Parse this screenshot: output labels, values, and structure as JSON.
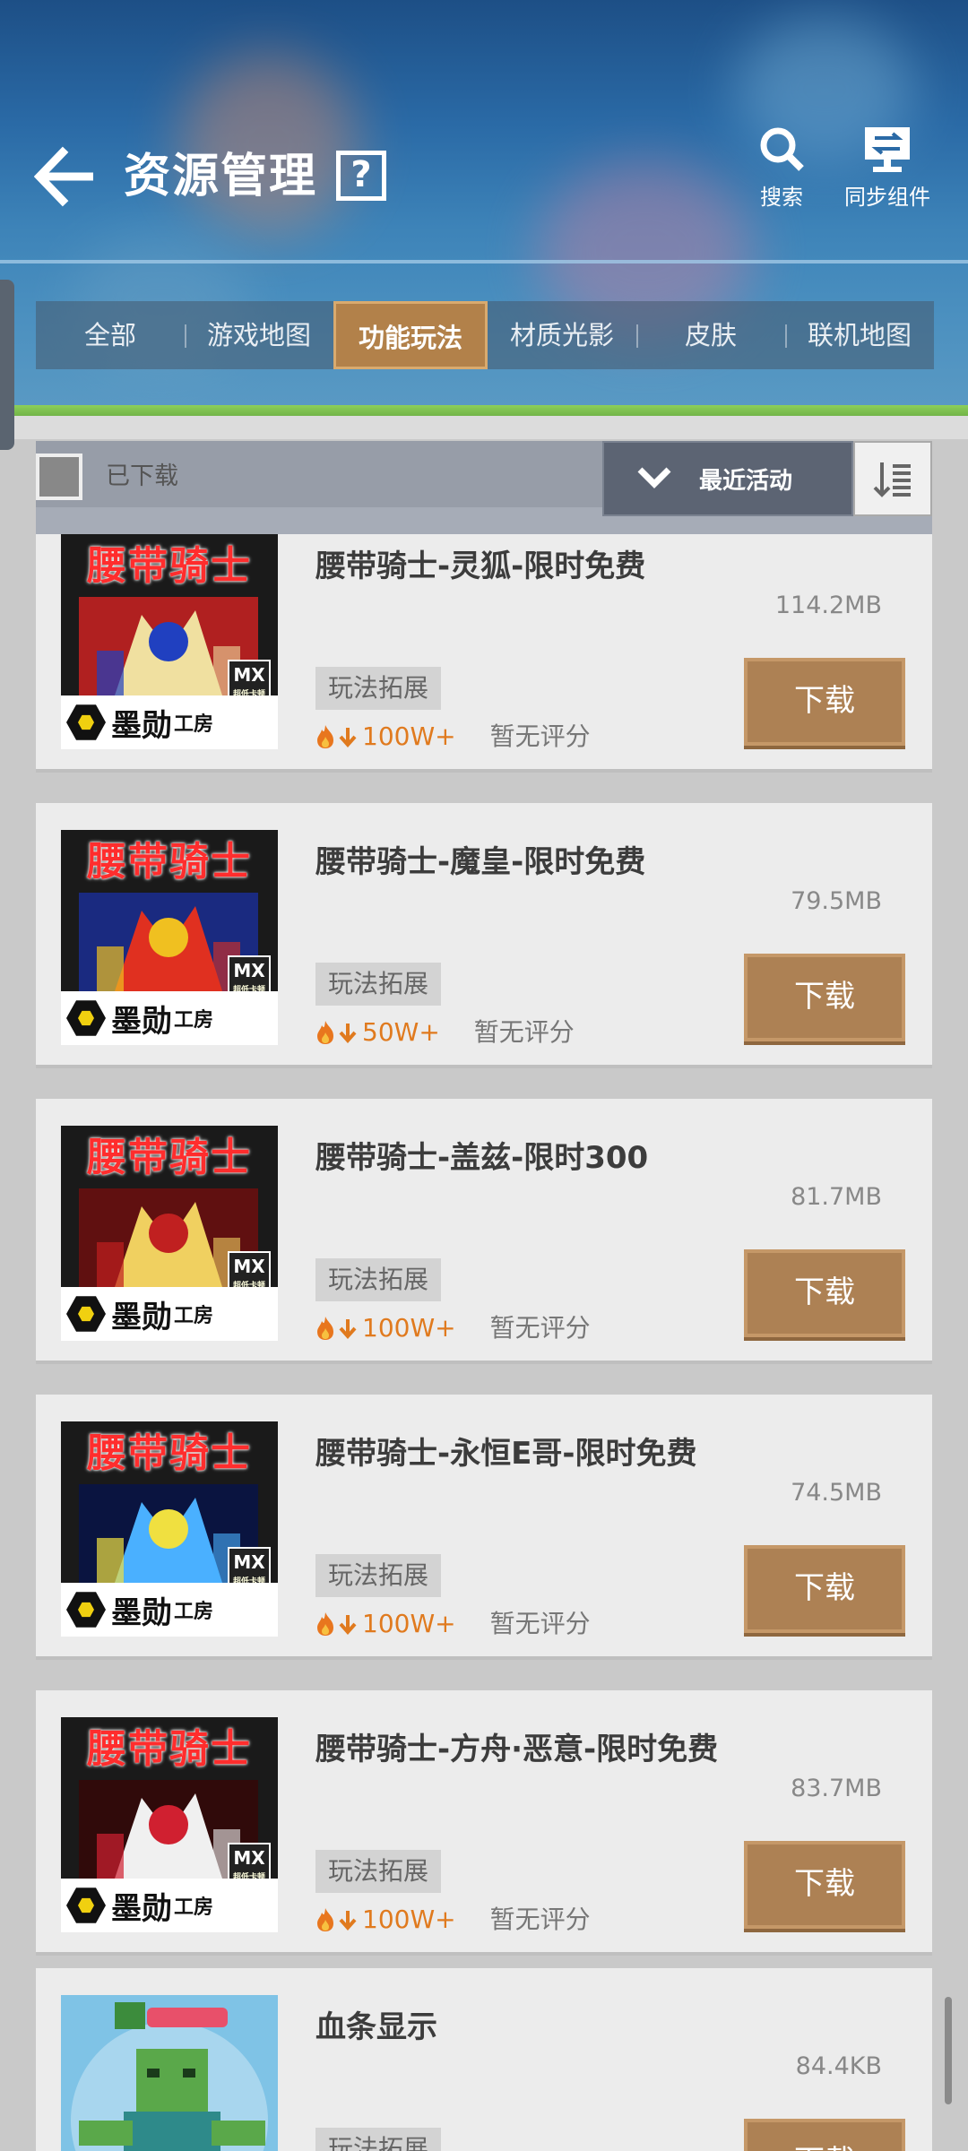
{
  "header": {
    "title": "资源管理",
    "help_icon": "?",
    "actions": {
      "search_label": "搜索",
      "sync_label": "同步组件"
    }
  },
  "tabs": [
    "全部",
    "游戏地图",
    "功能玩法",
    "材质光影",
    "皮肤",
    "联机地图"
  ],
  "active_tab": "功能玩法",
  "filter": {
    "downloaded_label": "已下载",
    "sort_label": "最近活动"
  },
  "items": [
    {
      "title": "腰带骑士-灵狐-限时免费",
      "size": "114.2MB",
      "tag": "玩法拓展",
      "downloads": "100W+",
      "rating": "暂无评分",
      "button": "下载",
      "banner": "腰带骑士",
      "subtitle": "灵狐"
    },
    {
      "title": "腰带骑士-魔皇-限时免费",
      "size": "79.5MB",
      "tag": "玩法拓展",
      "downloads": "50W+",
      "rating": "暂无评分",
      "button": "下载",
      "banner": "腰带骑士",
      "subtitle": ""
    },
    {
      "title": "腰带骑士-盖兹-限时300",
      "size": "81.7MB",
      "tag": "玩法拓展",
      "downloads": "100W+",
      "rating": "暂无评分",
      "button": "下载",
      "banner": "腰带骑士",
      "subtitle": ""
    },
    {
      "title": "腰带骑士-永恒E哥-限时免费",
      "size": "74.5MB",
      "tag": "玩法拓展",
      "downloads": "100W+",
      "rating": "暂无评分",
      "button": "下载",
      "banner": "腰带骑士",
      "subtitle": "永恒E哥"
    },
    {
      "title": "腰带骑士-方舟·恶意-限时免费",
      "size": "83.7MB",
      "tag": "玩法拓展",
      "downloads": "100W+",
      "rating": "暂无评分",
      "button": "下载",
      "banner": "腰带骑士",
      "subtitle": "方舟·恶意"
    },
    {
      "title": "血条显示",
      "size": "84.4KB",
      "tag": "玩法拓展",
      "downloads": "",
      "rating": "",
      "button": "下载",
      "banner": "",
      "subtitle": ""
    }
  ],
  "thumb_brand": {
    "logo_text": "墨勋",
    "logo_sub": "工房",
    "mx_badge": "MX",
    "mx_small": "超低卡顿"
  },
  "colors": {
    "accent_brown": "#ad8154",
    "header_blue": "#2a6aa6",
    "download_count_orange": "#e07a1e",
    "banner_red": "#ff2d2d",
    "green_line": "#8ccf5a"
  }
}
